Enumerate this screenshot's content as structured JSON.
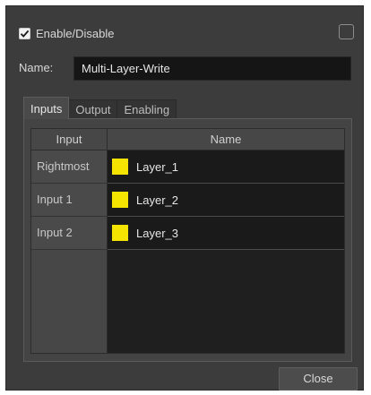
{
  "enable": {
    "label": "Enable/Disable",
    "checked": true
  },
  "name": {
    "label": "Name:",
    "value": "Multi-Layer-Write"
  },
  "tabs": [
    {
      "label": "Inputs",
      "active": true
    },
    {
      "label": "Output",
      "active": false
    },
    {
      "label": "Enabling",
      "active": false
    }
  ],
  "table": {
    "headers": {
      "input": "Input",
      "name": "Name"
    },
    "rows": [
      {
        "input": "Rightmost",
        "name": "Layer_1",
        "color": "#f5e300"
      },
      {
        "input": "Input 1",
        "name": "Layer_2",
        "color": "#f5e300"
      },
      {
        "input": "Input 2",
        "name": "Layer_3",
        "color": "#f5e300"
      }
    ]
  },
  "buttons": {
    "close": "Close"
  },
  "icons": {
    "enable_checkbox": "checkmark-icon",
    "right_checkbox": "empty-checkbox-icon"
  }
}
